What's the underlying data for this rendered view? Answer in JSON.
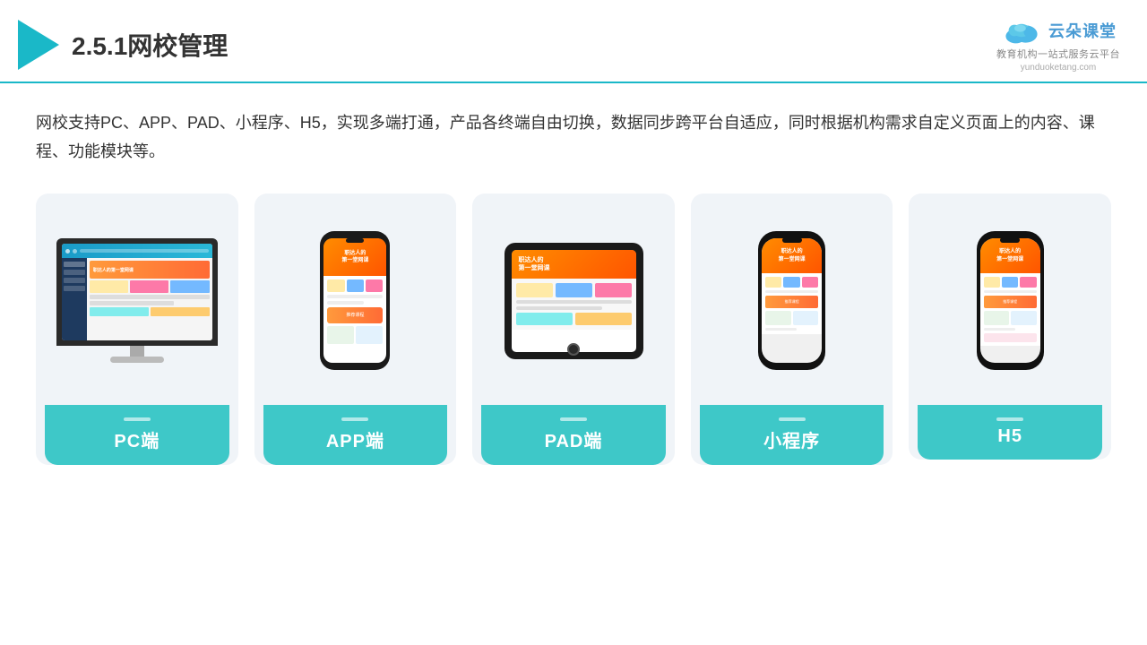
{
  "header": {
    "title": "2.5.1网校管理",
    "logo_text": "云朵课堂",
    "logo_sub": "教育机构一站\n式服务云平台",
    "logo_url": "yunduoketang.com"
  },
  "description": "网校支持PC、APP、PAD、小程序、H5，实现多端打通，产品各终端自由切换，数据同步跨平台自适应，同时根据机构需求自定义页面上的内容、课程、功能模块等。",
  "cards": [
    {
      "label": "PC端",
      "device": "pc"
    },
    {
      "label": "APP端",
      "device": "phone"
    },
    {
      "label": "PAD端",
      "device": "tablet"
    },
    {
      "label": "小程序",
      "device": "phone2"
    },
    {
      "label": "H5",
      "device": "phone3"
    }
  ]
}
